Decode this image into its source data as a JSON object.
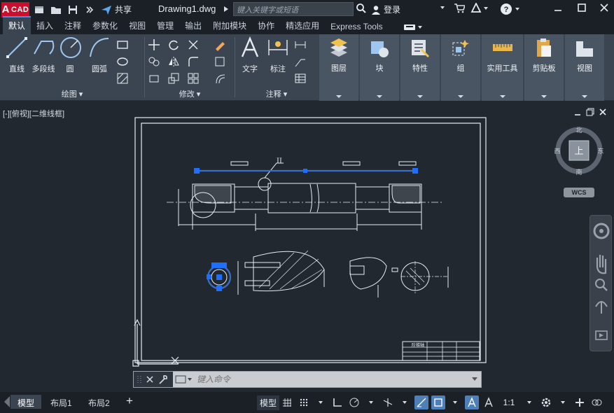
{
  "app": {
    "logo_text": "CAD",
    "logo_letter": "A",
    "doc_title": "Drawing1.dwg",
    "share_label": "共享",
    "search_placeholder": "键入关键字或短语",
    "login_label": "登录"
  },
  "tabs": [
    "默认",
    "插入",
    "注释",
    "参数化",
    "视图",
    "管理",
    "输出",
    "附加模块",
    "协作",
    "精选应用",
    "Express Tools"
  ],
  "active_tab": "默认",
  "ribbon": {
    "draw": {
      "title": "绘图",
      "tools": [
        "直线",
        "多段线",
        "圆",
        "圆弧"
      ]
    },
    "modify": {
      "title": "修改"
    },
    "annotate": {
      "title": "注释",
      "tools": [
        "文字",
        "标注"
      ]
    },
    "blue_panels": [
      "图层",
      "块",
      "特性",
      "组",
      "实用工具",
      "剪贴板",
      "视图"
    ]
  },
  "viewport": {
    "label": "[-][俯视][二维线框]",
    "viewcube": {
      "top_face": "上",
      "north": "北",
      "south": "南",
      "east": "东",
      "west": "西"
    },
    "wcs": "WCS",
    "drawing_marks": {
      "section_mark": "II",
      "title_block": "阶梯轴"
    }
  },
  "command": {
    "placeholder": "键入命令"
  },
  "status": {
    "layout_tabs": [
      "模型",
      "布局1",
      "布局2"
    ],
    "active_layout": "模型",
    "model_label": "模型",
    "scale": "1:1"
  },
  "colors": {
    "accent": "#4a90d9",
    "grip": "#1f6fff",
    "selection": "#3b6fc7",
    "logo": "#c8102e"
  }
}
